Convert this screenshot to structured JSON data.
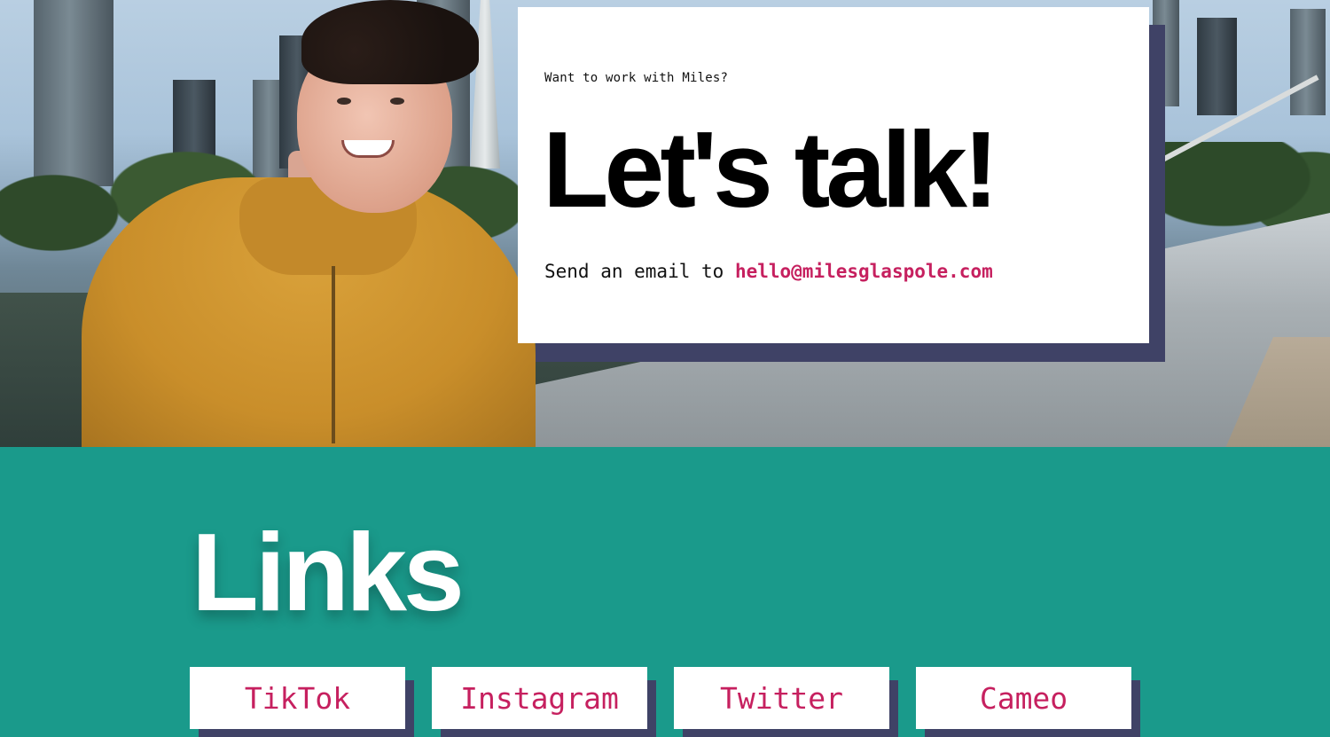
{
  "hero": {
    "eyebrow": "Want to work with Miles?",
    "headline": "Let's talk!",
    "cta_prefix": "Send an email to ",
    "email": "hello@milesglaspole.com"
  },
  "links": {
    "title": "Links",
    "items": [
      {
        "label": "TikTok"
      },
      {
        "label": "Instagram"
      },
      {
        "label": "Twitter"
      },
      {
        "label": "Cameo"
      }
    ]
  },
  "colors": {
    "teal_background": "#1a9a8b",
    "accent_pink": "#c6205f",
    "card_shadow": "#3f4266",
    "card_background": "#ffffff"
  }
}
